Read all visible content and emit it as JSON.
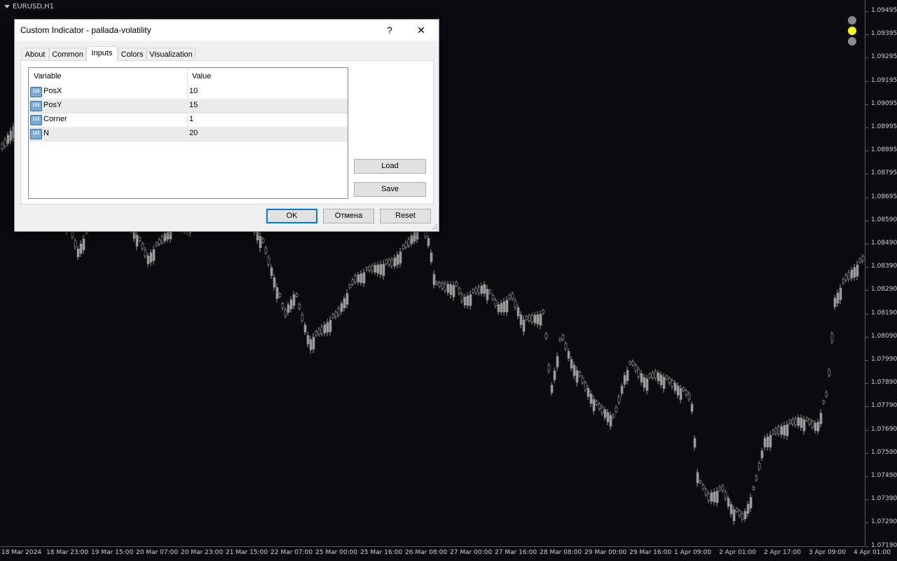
{
  "chart": {
    "symbol": "EURUSD,H1",
    "price_labels": [
      "1.09495",
      "1.09395",
      "1.09295",
      "1.09195",
      "1.09095",
      "1.08995",
      "1.08895",
      "1.08795",
      "1.08695",
      "1.08590",
      "1.08490",
      "1.08390",
      "1.08290",
      "1.08190",
      "1.08090",
      "1.07990",
      "1.07890",
      "1.07790",
      "1.07690",
      "1.07590",
      "1.07490",
      "1.07390",
      "1.07290",
      "1.07190"
    ],
    "time_labels": [
      "18 Mar 2024",
      "18 Mar 23:00",
      "19 Mar 15:00",
      "20 Mar 07:00",
      "20 Mar 23:00",
      "21 Mar 15:00",
      "22 Mar 07:00",
      "25 Mar 00:00",
      "25 Mar 16:00",
      "26 Mar 08:00",
      "27 Mar 00:00",
      "27 Mar 16:00",
      "28 Mar 08:00",
      "29 Mar 00:00",
      "29 Mar 16:00",
      "1 Apr 09:00",
      "2 Apr 01:00",
      "2 Apr 17:00",
      "3 Apr 09:00",
      "4 Apr 01:00"
    ],
    "status_dot_colors": [
      "#8a8a8a",
      "#ffff00",
      "#8a8a8a"
    ],
    "candle_color": "#9a9a9a"
  },
  "dialog": {
    "title": "Custom Indicator - pallada-volatility",
    "help_label": "?",
    "close_label": "✕",
    "tabs": [
      "About",
      "Common",
      "Inputs",
      "Colors",
      "Visualization"
    ],
    "active_tab": "Inputs",
    "grid": {
      "col_variable": "Variable",
      "col_value": "Value",
      "icon_text": "123",
      "rows": [
        {
          "variable": "PosX",
          "value": "10"
        },
        {
          "variable": "PosY",
          "value": "15"
        },
        {
          "variable": "Corner",
          "value": "1"
        },
        {
          "variable": "N",
          "value": "20"
        }
      ]
    },
    "load_label": "Load",
    "save_label": "Save",
    "ok_label": "OK",
    "cancel_label": "Отмена",
    "reset_label": "Reset"
  }
}
